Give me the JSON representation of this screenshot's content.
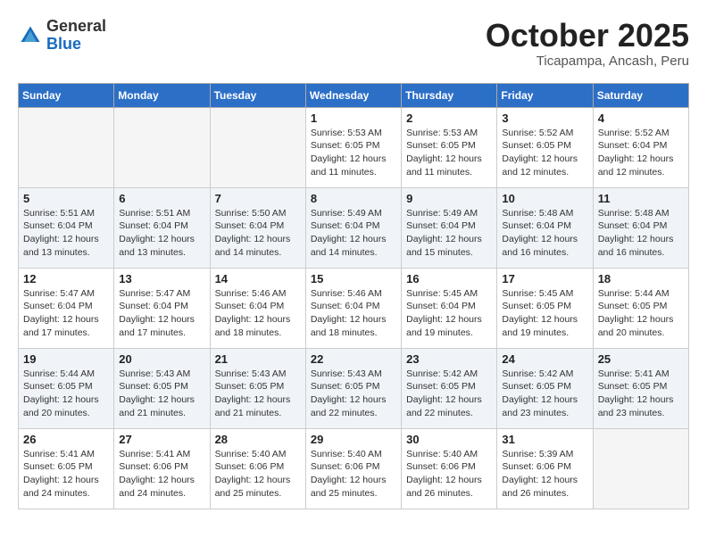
{
  "header": {
    "logo_general": "General",
    "logo_blue": "Blue",
    "month_title": "October 2025",
    "location": "Ticapampa, Ancash, Peru"
  },
  "columns": [
    "Sunday",
    "Monday",
    "Tuesday",
    "Wednesday",
    "Thursday",
    "Friday",
    "Saturday"
  ],
  "weeks": [
    [
      {
        "day": "",
        "info": ""
      },
      {
        "day": "",
        "info": ""
      },
      {
        "day": "",
        "info": ""
      },
      {
        "day": "1",
        "info": "Sunrise: 5:53 AM\nSunset: 6:05 PM\nDaylight: 12 hours and 11 minutes."
      },
      {
        "day": "2",
        "info": "Sunrise: 5:53 AM\nSunset: 6:05 PM\nDaylight: 12 hours and 11 minutes."
      },
      {
        "day": "3",
        "info": "Sunrise: 5:52 AM\nSunset: 6:05 PM\nDaylight: 12 hours and 12 minutes."
      },
      {
        "day": "4",
        "info": "Sunrise: 5:52 AM\nSunset: 6:04 PM\nDaylight: 12 hours and 12 minutes."
      }
    ],
    [
      {
        "day": "5",
        "info": "Sunrise: 5:51 AM\nSunset: 6:04 PM\nDaylight: 12 hours and 13 minutes."
      },
      {
        "day": "6",
        "info": "Sunrise: 5:51 AM\nSunset: 6:04 PM\nDaylight: 12 hours and 13 minutes."
      },
      {
        "day": "7",
        "info": "Sunrise: 5:50 AM\nSunset: 6:04 PM\nDaylight: 12 hours and 14 minutes."
      },
      {
        "day": "8",
        "info": "Sunrise: 5:49 AM\nSunset: 6:04 PM\nDaylight: 12 hours and 14 minutes."
      },
      {
        "day": "9",
        "info": "Sunrise: 5:49 AM\nSunset: 6:04 PM\nDaylight: 12 hours and 15 minutes."
      },
      {
        "day": "10",
        "info": "Sunrise: 5:48 AM\nSunset: 6:04 PM\nDaylight: 12 hours and 16 minutes."
      },
      {
        "day": "11",
        "info": "Sunrise: 5:48 AM\nSunset: 6:04 PM\nDaylight: 12 hours and 16 minutes."
      }
    ],
    [
      {
        "day": "12",
        "info": "Sunrise: 5:47 AM\nSunset: 6:04 PM\nDaylight: 12 hours and 17 minutes."
      },
      {
        "day": "13",
        "info": "Sunrise: 5:47 AM\nSunset: 6:04 PM\nDaylight: 12 hours and 17 minutes."
      },
      {
        "day": "14",
        "info": "Sunrise: 5:46 AM\nSunset: 6:04 PM\nDaylight: 12 hours and 18 minutes."
      },
      {
        "day": "15",
        "info": "Sunrise: 5:46 AM\nSunset: 6:04 PM\nDaylight: 12 hours and 18 minutes."
      },
      {
        "day": "16",
        "info": "Sunrise: 5:45 AM\nSunset: 6:04 PM\nDaylight: 12 hours and 19 minutes."
      },
      {
        "day": "17",
        "info": "Sunrise: 5:45 AM\nSunset: 6:05 PM\nDaylight: 12 hours and 19 minutes."
      },
      {
        "day": "18",
        "info": "Sunrise: 5:44 AM\nSunset: 6:05 PM\nDaylight: 12 hours and 20 minutes."
      }
    ],
    [
      {
        "day": "19",
        "info": "Sunrise: 5:44 AM\nSunset: 6:05 PM\nDaylight: 12 hours and 20 minutes."
      },
      {
        "day": "20",
        "info": "Sunrise: 5:43 AM\nSunset: 6:05 PM\nDaylight: 12 hours and 21 minutes."
      },
      {
        "day": "21",
        "info": "Sunrise: 5:43 AM\nSunset: 6:05 PM\nDaylight: 12 hours and 21 minutes."
      },
      {
        "day": "22",
        "info": "Sunrise: 5:43 AM\nSunset: 6:05 PM\nDaylight: 12 hours and 22 minutes."
      },
      {
        "day": "23",
        "info": "Sunrise: 5:42 AM\nSunset: 6:05 PM\nDaylight: 12 hours and 22 minutes."
      },
      {
        "day": "24",
        "info": "Sunrise: 5:42 AM\nSunset: 6:05 PM\nDaylight: 12 hours and 23 minutes."
      },
      {
        "day": "25",
        "info": "Sunrise: 5:41 AM\nSunset: 6:05 PM\nDaylight: 12 hours and 23 minutes."
      }
    ],
    [
      {
        "day": "26",
        "info": "Sunrise: 5:41 AM\nSunset: 6:05 PM\nDaylight: 12 hours and 24 minutes."
      },
      {
        "day": "27",
        "info": "Sunrise: 5:41 AM\nSunset: 6:06 PM\nDaylight: 12 hours and 24 minutes."
      },
      {
        "day": "28",
        "info": "Sunrise: 5:40 AM\nSunset: 6:06 PM\nDaylight: 12 hours and 25 minutes."
      },
      {
        "day": "29",
        "info": "Sunrise: 5:40 AM\nSunset: 6:06 PM\nDaylight: 12 hours and 25 minutes."
      },
      {
        "day": "30",
        "info": "Sunrise: 5:40 AM\nSunset: 6:06 PM\nDaylight: 12 hours and 26 minutes."
      },
      {
        "day": "31",
        "info": "Sunrise: 5:39 AM\nSunset: 6:06 PM\nDaylight: 12 hours and 26 minutes."
      },
      {
        "day": "",
        "info": ""
      }
    ]
  ]
}
